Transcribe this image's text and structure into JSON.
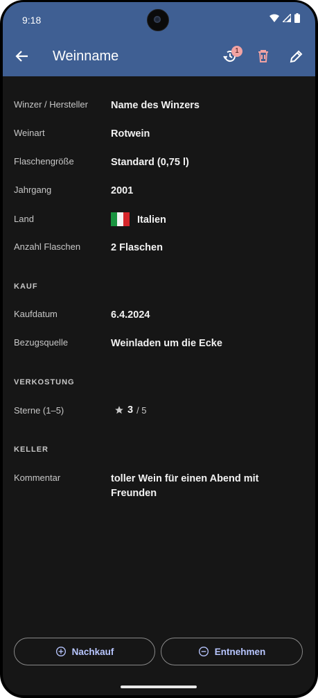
{
  "status": {
    "time": "9:18"
  },
  "appbar": {
    "title": "Weinname",
    "badge_count": "1"
  },
  "details": {
    "producer_label": "Winzer / Hersteller",
    "producer_value": "Name des Winzers",
    "type_label": "Weinart",
    "type_value": "Rotwein",
    "bottle_label": "Flaschengröße",
    "bottle_value": "Standard (0,75 l)",
    "vintage_label": "Jahrgang",
    "vintage_value": "2001",
    "country_label": "Land",
    "country_value": "Italien",
    "count_label": "Anzahl Flaschen",
    "count_value": "2 Flaschen"
  },
  "purchase": {
    "header": "KAUF",
    "date_label": "Kaufdatum",
    "date_value": "6.4.2024",
    "source_label": "Bezugsquelle",
    "source_value": "Weinladen um die Ecke"
  },
  "tasting": {
    "header": "VERKOSTUNG",
    "stars_label": "Sterne (1–5)",
    "stars_value": "3",
    "stars_max": "/ 5"
  },
  "cellar": {
    "header": "KELLER",
    "comment_label": "Kommentar",
    "comment_value": "toller Wein für einen Abend mit Freunden"
  },
  "actions": {
    "rebuy": "Nachkauf",
    "remove": "Entnehmen"
  },
  "colors": {
    "appbar": "#3f5f93",
    "background": "#161616",
    "accent": "#b8c6ff",
    "delete": "#f2a3a3"
  }
}
